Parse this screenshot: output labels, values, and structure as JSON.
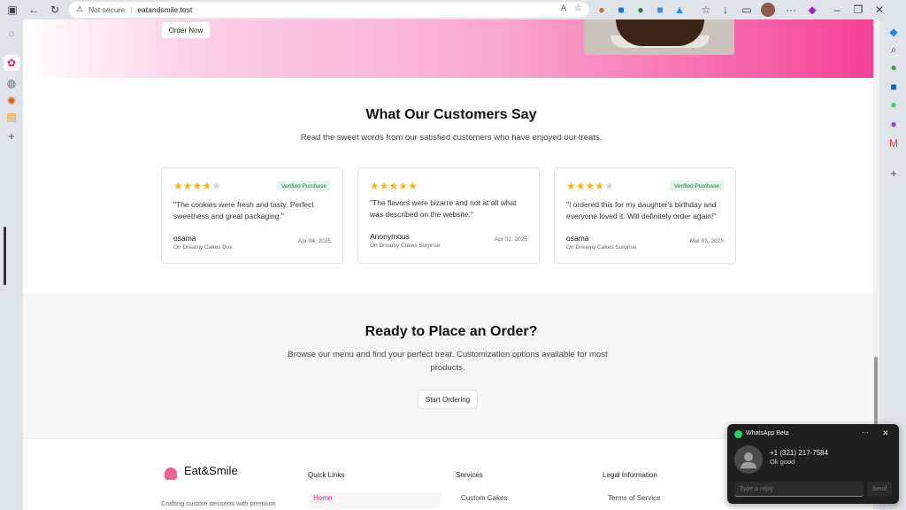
{
  "browser": {
    "security_label": "Not secure",
    "url": "eatandsmile.test"
  },
  "hero": {
    "order_button": "Order Now"
  },
  "testimonials": {
    "title": "What Our Customers Say",
    "subtitle": "Read the sweet words from our satisfied customers who have enjoyed our treats.",
    "reviews": [
      {
        "rating": 4,
        "badge": "Verified Purchase",
        "quote": "\"The cookies were fresh and tasty. Perfect sweetness and great packaging.\"",
        "name": "osama",
        "product": "On Dreamy Cakes Box",
        "date": "Apr 04, 2025"
      },
      {
        "rating": 5,
        "badge": "",
        "quote": "\"The flavors were bizarre and not at all what was described on the website.\"",
        "name": "Anonymous",
        "product": "On Dreamy Cakes Surprise",
        "date": "Apr 02, 2025"
      },
      {
        "rating": 4,
        "badge": "Verified Purchase",
        "quote": "\"I ordered this for my daughter's birthday and everyone loved it. Will definitely order again!\"",
        "name": "osama",
        "product": "On Dreamy Cakes Surprise",
        "date": "Mar 03, 2025"
      }
    ]
  },
  "cta": {
    "title": "Ready to Place an Order?",
    "text": "Browse our menu and find your perfect treat. Customization options available for most products.",
    "button": "Start Ordering"
  },
  "footer": {
    "brand": "Eat&Smile",
    "tagline": "Crafting custom desserts with premium",
    "quick_links_title": "Quick Links",
    "quick_links_first": "Home",
    "services_title": "Services",
    "services_first": "Custom Cakes",
    "legal_title": "Legal Information",
    "legal_first": "Terms of Service"
  },
  "whatsapp": {
    "app_name": "WhatsApp Beta",
    "more": "···",
    "phone": "+1 (321) 217-7584",
    "message": "Ok good",
    "reply_placeholder": "Type a reply",
    "send": "Send"
  },
  "colors": {
    "accent_pink": "#f53f94",
    "star": "#f5b800",
    "badge_green": "#197a3f",
    "whatsapp_green": "#25d366"
  }
}
